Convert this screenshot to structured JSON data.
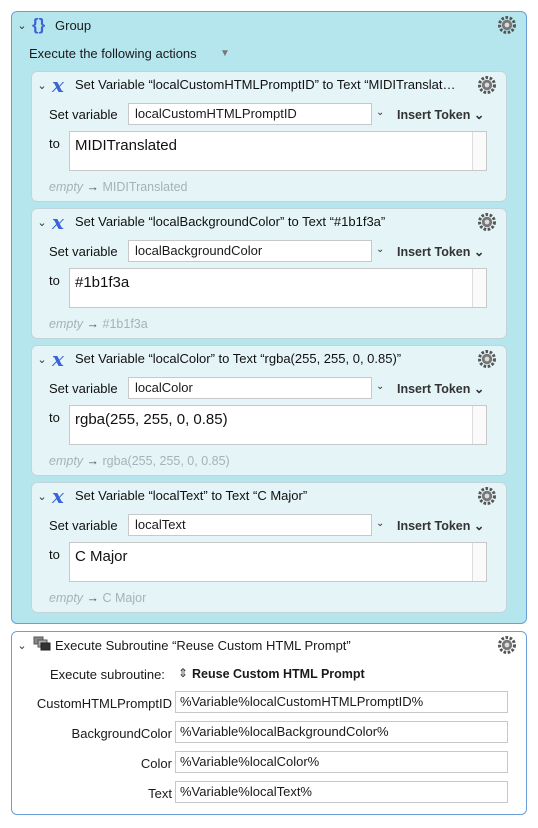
{
  "group": {
    "title": "Group",
    "execute_label": "Execute the following actions"
  },
  "actions": [
    {
      "title": "Set Variable “localCustomHTMLPromptID” to Text “MIDITranslat…",
      "set_label": "Set variable",
      "var_name": "localCustomHTMLPromptID",
      "insert_token": "Insert Token",
      "to_label": "to",
      "value": "MIDITranslated",
      "preview_empty": "empty",
      "preview_arrow": "→",
      "preview_value": "MIDITranslated"
    },
    {
      "title": "Set Variable “localBackgroundColor” to Text “#1b1f3a”",
      "set_label": "Set variable",
      "var_name": "localBackgroundColor",
      "insert_token": "Insert Token",
      "to_label": "to",
      "value": "#1b1f3a",
      "preview_empty": "empty",
      "preview_arrow": "→",
      "preview_value": "#1b1f3a"
    },
    {
      "title": "Set Variable “localColor” to Text “rgba(255, 255, 0, 0.85)”",
      "set_label": "Set variable",
      "var_name": "localColor",
      "insert_token": "Insert Token",
      "to_label": "to",
      "value": "rgba(255, 255, 0, 0.85)",
      "preview_empty": "empty",
      "preview_arrow": "→",
      "preview_value": "rgba(255, 255, 0, 0.85)"
    },
    {
      "title": "Set Variable “localText” to Text “C Major”",
      "set_label": "Set variable",
      "var_name": "localText",
      "insert_token": "Insert Token",
      "to_label": "to",
      "value": "C Major",
      "preview_empty": "empty",
      "preview_arrow": "→",
      "preview_value": "C Major"
    }
  ],
  "subroutine": {
    "title": "Execute Subroutine “Reuse Custom HTML Prompt”",
    "execute_label": "Execute subroutine:",
    "selected": "Reuse Custom HTML Prompt",
    "params": [
      {
        "label": "CustomHTMLPromptID",
        "value": "%Variable%localCustomHTMLPromptID%"
      },
      {
        "label": "BackgroundColor",
        "value": "%Variable%localBackgroundColor%"
      },
      {
        "label": "Color",
        "value": "%Variable%localColor%"
      },
      {
        "label": "Text",
        "value": "%Variable%localText%"
      }
    ]
  },
  "colors": {
    "group_bg": "#b5e6ee",
    "group_border": "#6a9fd8",
    "action_bg": "#e4f4f7",
    "variable_icon": "#3b63d8",
    "group_icon": "#3b63d8"
  }
}
